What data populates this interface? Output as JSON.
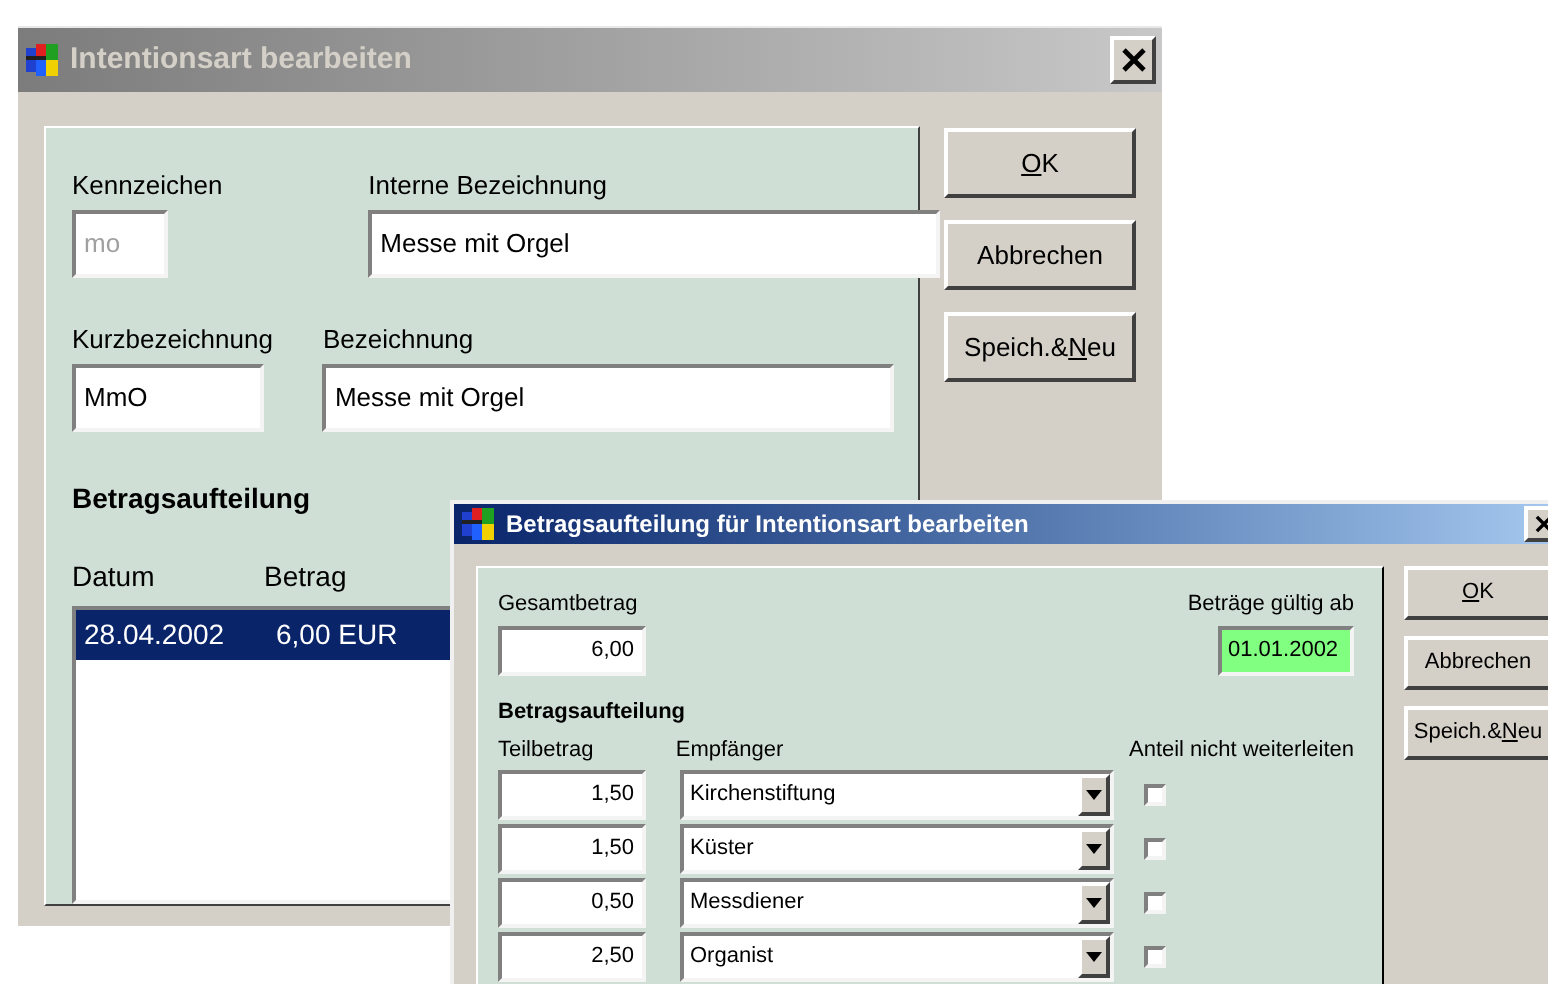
{
  "main_dialog": {
    "title": "Intentionsart bearbeiten",
    "active": false,
    "fields": [
      {
        "label": "Kennzeichen",
        "value": "mo",
        "disabled": true
      },
      {
        "label": "Interne Bezeichnung",
        "value": "Messe mit Orgel",
        "disabled": false
      },
      {
        "label": "Kurzbezeichnung",
        "value": "MmO",
        "disabled": false
      },
      {
        "label": "Bezeichnung",
        "value": "Messe mit Orgel",
        "disabled": false
      }
    ],
    "section_title": "Betragsaufteilung",
    "list": {
      "columns": [
        "Datum",
        "Betrag"
      ],
      "rows": [
        {
          "cells": [
            "28.04.2002",
            "6,00 EUR"
          ],
          "selected": true
        }
      ]
    },
    "buttons": [
      {
        "key": "O",
        "post": "K"
      },
      {
        "pre": "Abbrechen"
      },
      {
        "pre": "Speich.& ",
        "key": "N",
        "post": "eu"
      }
    ]
  },
  "split_dialog": {
    "title": "Betragsaufteilung für Intentionsart bearbeiten",
    "active": true,
    "total": {
      "label": "Gesamtbetrag",
      "value": "6,00"
    },
    "valid_from": {
      "label": "Beträge gültig ab",
      "value": "01.01.2002",
      "highlighted": true
    },
    "section_title": "Betragsaufteilung",
    "columns": [
      "Teilbetrag",
      "Empfänger",
      "Anteil nicht weiterleiten"
    ],
    "rows": [
      {
        "amount": "1,50",
        "recipient": "Kirchenstiftung",
        "checked": false
      },
      {
        "amount": "1,50",
        "recipient": "Küster",
        "checked": false
      },
      {
        "amount": "0,50",
        "recipient": "Messdiener",
        "checked": false
      },
      {
        "amount": "2,50",
        "recipient": "Organist",
        "checked": false
      }
    ],
    "buttons": [
      {
        "key": "O",
        "post": "K"
      },
      {
        "pre": "Abbrechen"
      },
      {
        "pre": "Speich.& ",
        "key": "N",
        "post": "eu"
      }
    ]
  }
}
